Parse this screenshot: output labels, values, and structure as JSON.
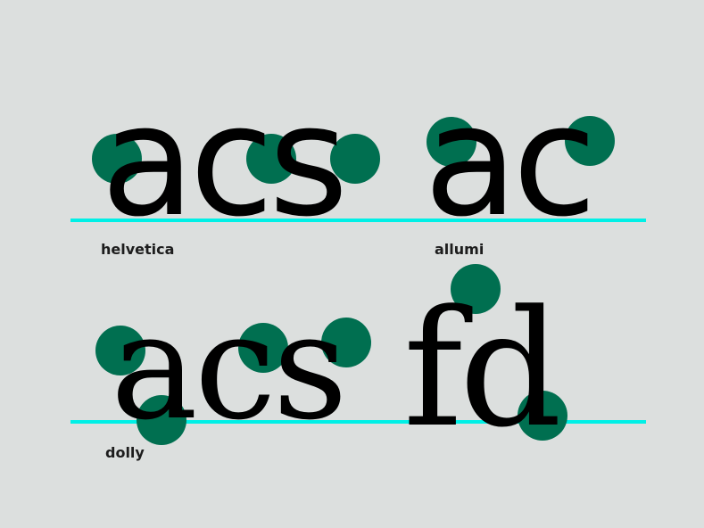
{
  "colors": {
    "background": "#dcdfde",
    "baseline": "#00f0e6",
    "dot": "#006f50",
    "glyph": "#000000"
  },
  "specimens": [
    {
      "glyphs": "acs",
      "label": "helvetica"
    },
    {
      "glyphs": "ac",
      "label": "allumi"
    },
    {
      "glyphs": "acs",
      "label": "dolly"
    },
    {
      "glyphs": "fd",
      "label": ""
    }
  ]
}
